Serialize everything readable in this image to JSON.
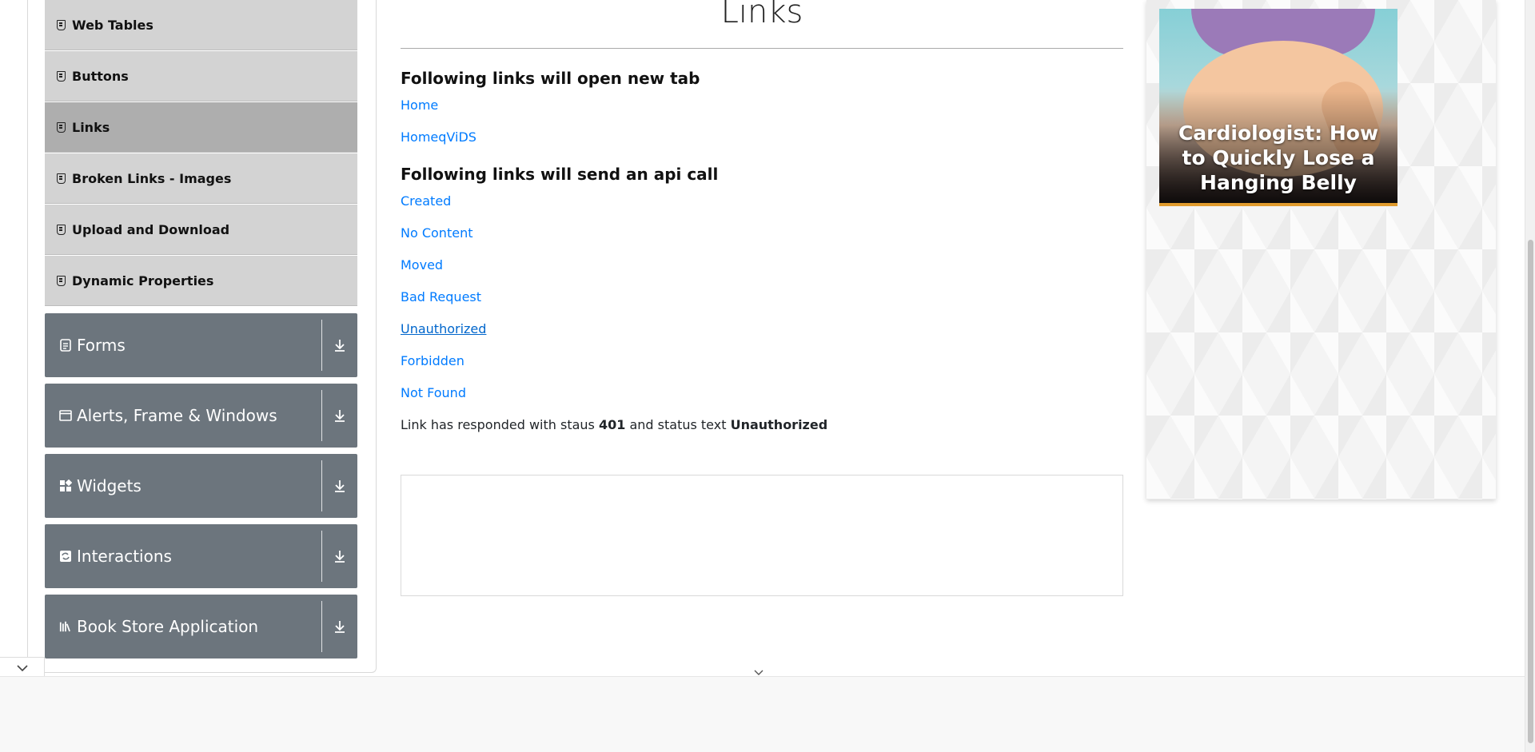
{
  "sidebar": {
    "elements_items": [
      {
        "label": "Web Tables"
      },
      {
        "label": "Buttons"
      },
      {
        "label": "Links"
      },
      {
        "label": "Broken Links - Images"
      },
      {
        "label": "Upload and Download"
      },
      {
        "label": "Dynamic Properties"
      }
    ],
    "active_item": "Links",
    "groups": [
      {
        "label": "Forms",
        "icon": "form-icon"
      },
      {
        "label": "Alerts, Frame & Windows",
        "icon": "window-icon"
      },
      {
        "label": "Widgets",
        "icon": "widgets-icon"
      },
      {
        "label": "Interactions",
        "icon": "interactions-icon"
      },
      {
        "label": "Book Store Application",
        "icon": "books-icon"
      }
    ]
  },
  "main": {
    "title": "Links",
    "new_tab_heading": "Following links will open new tab",
    "new_tab_links": [
      "Home",
      "HomeqViDS"
    ],
    "api_heading": "Following links will send an api call",
    "api_links": [
      "Created",
      "No Content",
      "Moved",
      "Bad Request",
      "Unauthorized",
      "Forbidden",
      "Not Found"
    ],
    "hovered_link": "Unauthorized",
    "response": {
      "prefix": "Link has responded with staus",
      "status_code": "401",
      "middle": "and status text",
      "status_text": "Unauthorized"
    }
  },
  "ad": {
    "headline": "Cardiologist: How to Quickly Lose a Hanging Belly"
  },
  "colors": {
    "link": "#007bff",
    "group_bg": "#6c757d",
    "sub_item_bg": "#d3d3d3",
    "sub_item_active_bg": "#aeaeae"
  }
}
